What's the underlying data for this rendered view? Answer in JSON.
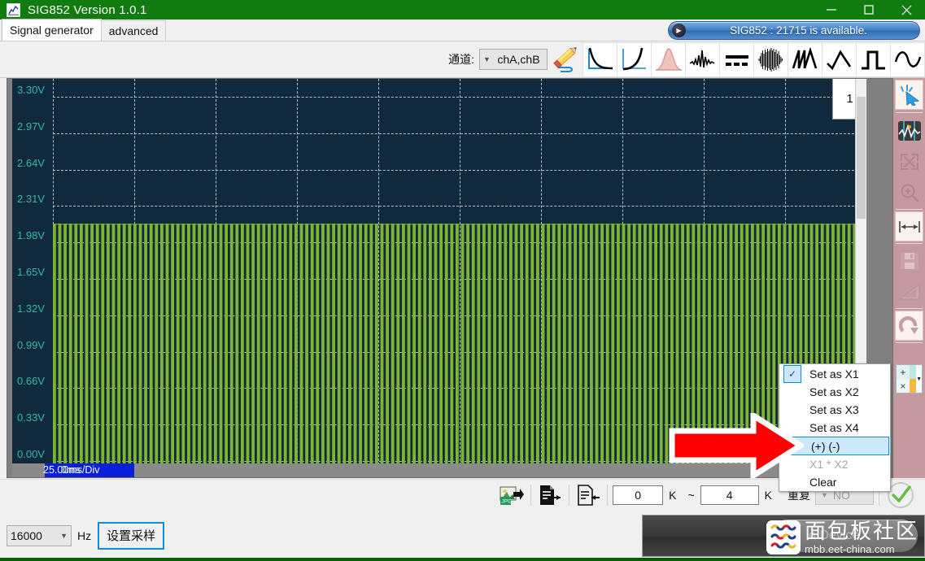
{
  "window": {
    "title": "SIG852  Version 1.0.1",
    "app_icon": "chart-icon",
    "minimize": "minimize-icon",
    "maximize": "maximize-icon",
    "close": "close-icon"
  },
  "tabs": [
    {
      "label": "Signal generator",
      "active": true
    },
    {
      "label": "advanced",
      "active": false
    }
  ],
  "status_pill": {
    "icon": "play-icon",
    "text": "SIG852 : 21715 is available."
  },
  "wavebar": {
    "channel_label": "通道:",
    "channel_value": "chA,chB",
    "chevron": "chevron-down-icon",
    "pencil_icon": "pencil-edit-icon",
    "buttons": [
      {
        "name": "wave-exp-decay",
        "icon": "exponential-decay-icon"
      },
      {
        "name": "wave-exp-rise",
        "icon": "exponential-rise-icon"
      },
      {
        "name": "wave-gaussian",
        "icon": "gaussian-bell-icon"
      },
      {
        "name": "wave-noise",
        "icon": "noise-burst-icon"
      },
      {
        "name": "wave-dash-line",
        "icon": "dashed-level-icon"
      },
      {
        "name": "wave-dense-noise",
        "icon": "dense-noise-icon"
      },
      {
        "name": "wave-sawtooth",
        "icon": "sawtooth-icon"
      },
      {
        "name": "wave-triangle",
        "icon": "triangle-wave-icon"
      },
      {
        "name": "wave-square",
        "icon": "square-wave-icon"
      },
      {
        "name": "wave-sine",
        "icon": "sine-wave-icon"
      }
    ]
  },
  "plot": {
    "channel_badge": "1",
    "time_per_div": "25.00ms/Div",
    "time_origin": "0ms",
    "y_ticks": [
      "3.30V",
      "2.97V",
      "2.64V",
      "2.31V",
      "1.98V",
      "1.65V",
      "1.32V",
      "0.99V",
      "0.66V",
      "0.33V",
      "0.00V"
    ],
    "trace_color": "#7fb432",
    "background": "#11293d",
    "grid_color": "#cfd6dd",
    "axis_text_color": "#2fb9b0",
    "x_divisions": 10,
    "y_divisions": 10
  },
  "right_toolbar": [
    {
      "name": "cursor-select-tool",
      "icon": "cursor-arrow-icon",
      "active": true
    },
    {
      "name": "measure-waveform-tool",
      "icon": "waveform-measure-icon",
      "active": false
    },
    {
      "name": "fit-expand-tool",
      "icon": "expand-arrows-icon",
      "active": false
    },
    {
      "name": "zoom-in-tool",
      "icon": "magnifier-plus-icon",
      "active": false
    },
    {
      "name": "horizontal-span-tool",
      "icon": "horizontal-arrows-icon",
      "active": true
    },
    {
      "name": "save-tool",
      "icon": "floppy-disk-icon",
      "active": false
    },
    {
      "name": "ruler-tool",
      "icon": "set-square-ruler-icon",
      "active": false
    },
    {
      "name": "redo-tool",
      "icon": "redo-arrow-icon",
      "active": true
    }
  ],
  "color_button": {
    "plus": "+",
    "times": "×",
    "caret": "caret-down-icon",
    "swatch_top": "#bfe6e3",
    "swatch_bottom": "#f5b942"
  },
  "context_menu": {
    "items": [
      {
        "label": "Set as X1",
        "checked": true,
        "selected": false,
        "disabled": false
      },
      {
        "label": "Set as X2",
        "checked": false,
        "selected": false,
        "disabled": false
      },
      {
        "label": "Set as X3",
        "checked": false,
        "selected": false,
        "disabled": false
      },
      {
        "label": "Set as X4",
        "checked": false,
        "selected": false,
        "disabled": false
      },
      {
        "label": "(+)  (-)",
        "checked": false,
        "selected": true,
        "disabled": false
      },
      {
        "label": "X1 * X2",
        "checked": false,
        "selected": false,
        "disabled": true
      },
      {
        "label": "Clear",
        "checked": false,
        "selected": false,
        "disabled": false
      }
    ],
    "check_glyph": "✓"
  },
  "annotation": {
    "arrow": "red-right-arrow",
    "color": "#ff0000"
  },
  "bottom_toolbar": {
    "export_jpg_icon": "export-jpg-icon",
    "export_file_icon": "export-document-icon",
    "import_file_icon": "import-document-icon",
    "range_from": "0",
    "range_from_unit": "K",
    "range_sep": "~",
    "range_to": "4",
    "range_to_unit": "K",
    "repeat_label": "重复",
    "repeat_value": "NO",
    "repeat_chevron": "chevron-down-icon",
    "confirm_icon": "green-check-circle-icon"
  },
  "footer": {
    "sample_rate": "16000",
    "sample_rate_chevron": "chevron-down-icon",
    "unit": "Hz",
    "set_sample_button": "设置采样",
    "device_text": "o Device"
  },
  "watermark": {
    "logo": "mbb-logo-icon",
    "cn_text": "面包板社区",
    "url": "mbb.eet-china.com"
  },
  "colors": {
    "title_green": "#107c10",
    "accent_blue": "#0a8ee0",
    "trace_green": "#7fb432",
    "plot_bg": "#11293d",
    "toolbar_pink": "#c49aa0"
  }
}
